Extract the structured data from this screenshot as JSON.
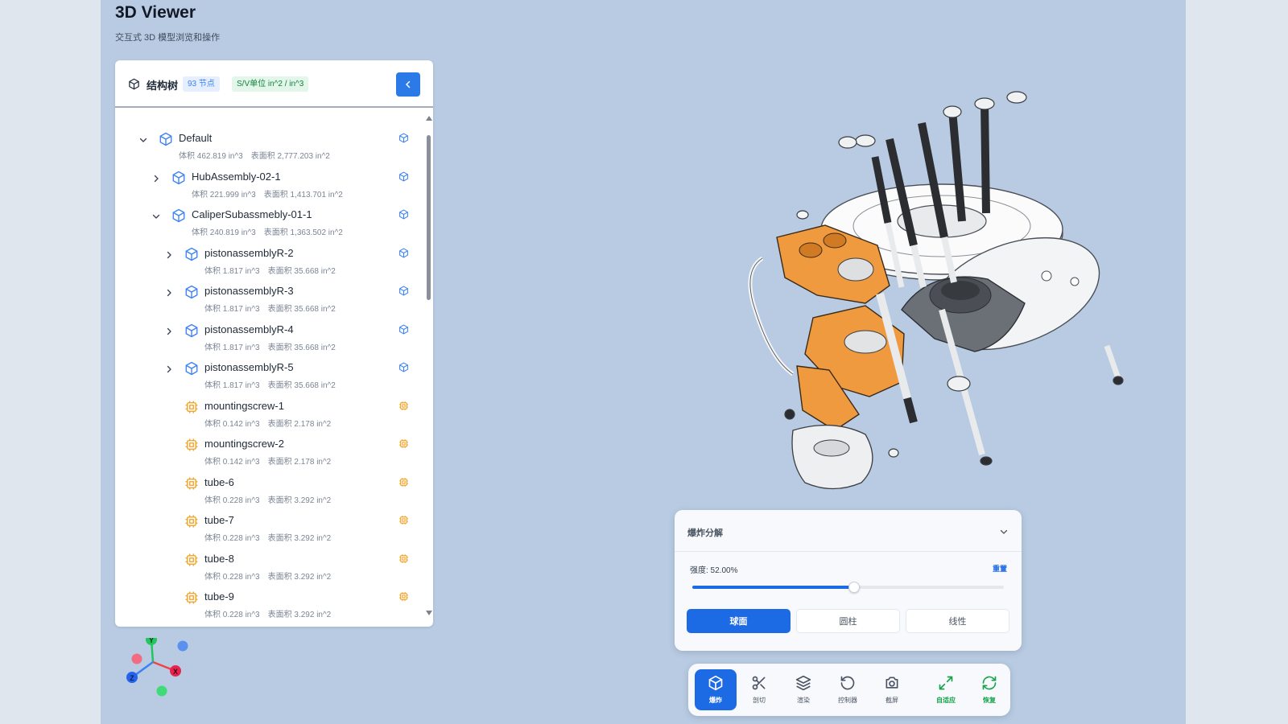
{
  "header": {
    "title": "3D Viewer",
    "subtitle": "交互式 3D 模型浏览和操作"
  },
  "tree": {
    "title": "结构树",
    "node_count_badge": "93 节点",
    "units_badge": "S/V单位 in^2 / in^3",
    "items": [
      {
        "name": "Default",
        "volume": "体积 462.819 in^3",
        "area": "表面积 2,777.203 in^2",
        "type": "assembly",
        "expander": "expanded",
        "level": 0
      },
      {
        "name": "HubAssembly-02-1",
        "volume": "体积 221.999 in^3",
        "area": "表面积 1,413.701 in^2",
        "type": "assembly",
        "expander": "collapsed",
        "level": 1
      },
      {
        "name": "CaliperSubassmebly-01-1",
        "volume": "体积 240.819 in^3",
        "area": "表面积 1,363.502 in^2",
        "type": "assembly",
        "expander": "expanded",
        "level": 1
      },
      {
        "name": "pistonassemblyR-2",
        "volume": "体积 1.817 in^3",
        "area": "表面积 35.668 in^2",
        "type": "assembly",
        "expander": "collapsed",
        "level": 2
      },
      {
        "name": "pistonassemblyR-3",
        "volume": "体积 1.817 in^3",
        "area": "表面积 35.668 in^2",
        "type": "assembly",
        "expander": "collapsed",
        "level": 2
      },
      {
        "name": "pistonassemblyR-4",
        "volume": "体积 1.817 in^3",
        "area": "表面积 35.668 in^2",
        "type": "assembly",
        "expander": "collapsed",
        "level": 2
      },
      {
        "name": "pistonassemblyR-5",
        "volume": "体积 1.817 in^3",
        "area": "表面积 35.668 in^2",
        "type": "assembly",
        "expander": "collapsed",
        "level": 2
      },
      {
        "name": "mountingscrew-1",
        "volume": "体积 0.142 in^3",
        "area": "表面积 2.178 in^2",
        "type": "part",
        "expander": "none",
        "level": 2
      },
      {
        "name": "mountingscrew-2",
        "volume": "体积 0.142 in^3",
        "area": "表面积 2.178 in^2",
        "type": "part",
        "expander": "none",
        "level": 2
      },
      {
        "name": "tube-6",
        "volume": "体积 0.228 in^3",
        "area": "表面积 3.292 in^2",
        "type": "part",
        "expander": "none",
        "level": 2
      },
      {
        "name": "tube-7",
        "volume": "体积 0.228 in^3",
        "area": "表面积 3.292 in^2",
        "type": "part",
        "expander": "none",
        "level": 2
      },
      {
        "name": "tube-8",
        "volume": "体积 0.228 in^3",
        "area": "表面积 3.292 in^2",
        "type": "part",
        "expander": "none",
        "level": 2
      },
      {
        "name": "tube-9",
        "volume": "体积 0.228 in^3",
        "area": "表面积 3.292 in^2",
        "type": "part",
        "expander": "none",
        "level": 2
      }
    ]
  },
  "axes": {
    "x": "X",
    "y": "Y",
    "z": "Z"
  },
  "explode": {
    "title": "爆炸分解",
    "strength_label": "强度: 52.00%",
    "strength_value": 0.52,
    "reset_label": "重置",
    "modes": [
      {
        "label": "球面",
        "active": true
      },
      {
        "label": "圆柱",
        "active": false
      },
      {
        "label": "线性",
        "active": false
      }
    ]
  },
  "toolbar": {
    "tools": [
      {
        "label": "爆炸",
        "icon": "cube-icon",
        "style": "active"
      },
      {
        "label": "剖切",
        "icon": "scissors-icon",
        "style": "normal"
      },
      {
        "label": "渲染",
        "icon": "layers-icon",
        "style": "normal"
      },
      {
        "label": "控制器",
        "icon": "rotate-icon",
        "style": "normal"
      },
      {
        "label": "截屏",
        "icon": "camera-icon",
        "style": "normal"
      },
      {
        "label": "自适应",
        "icon": "expand-icon",
        "style": "green"
      },
      {
        "label": "恢复",
        "icon": "refresh-icon",
        "style": "green"
      }
    ]
  },
  "colors": {
    "accent": "#1d6ae5",
    "assembly_icon": "#3b82f6",
    "part_icon": "#f0a020",
    "success": "#16a34a",
    "model_orange": "#ef9a3e",
    "background": "#b8cbe2"
  }
}
